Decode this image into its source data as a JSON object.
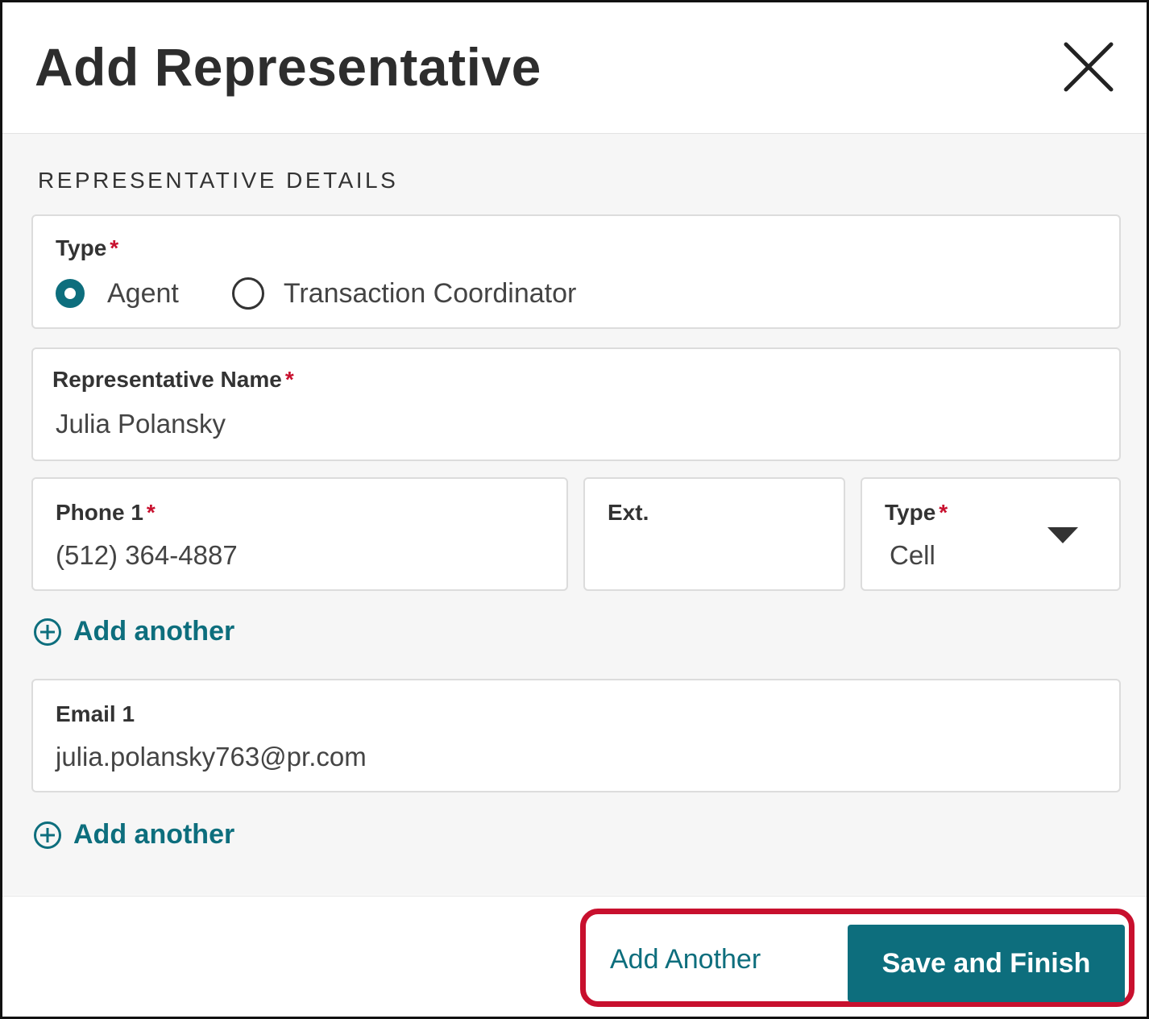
{
  "dialog": {
    "title": "Add Representative",
    "close_icon": "close-icon"
  },
  "section": {
    "label": "REPRESENTATIVE DETAILS"
  },
  "type_field": {
    "label": "Type",
    "required_mark": "*",
    "options": [
      {
        "label": "Agent",
        "selected": true
      },
      {
        "label": "Transaction Coordinator",
        "selected": false
      }
    ]
  },
  "name_field": {
    "label": "Representative Name",
    "required_mark": "*",
    "value": "Julia Polansky"
  },
  "phone_field": {
    "label": "Phone 1",
    "required_mark": "*",
    "value": "(512) 364-4887"
  },
  "ext_field": {
    "label": "Ext.",
    "value": ""
  },
  "phone_type_field": {
    "label": "Type",
    "required_mark": "*",
    "value": "Cell",
    "dropdown_icon": "caret-down-icon"
  },
  "add_phone_link": {
    "label": "Add another",
    "icon": "plus-circle-icon"
  },
  "email_field": {
    "label": "Email 1",
    "value": "julia.polansky763@pr.com"
  },
  "add_email_link": {
    "label": "Add another",
    "icon": "plus-circle-icon"
  },
  "footer": {
    "add_another_label": "Add Another",
    "save_label": "Save and Finish"
  },
  "colors": {
    "accent": "#0d6e7d",
    "required": "#c8102e",
    "highlight": "#c8102e",
    "body_bg": "#f6f6f6"
  }
}
